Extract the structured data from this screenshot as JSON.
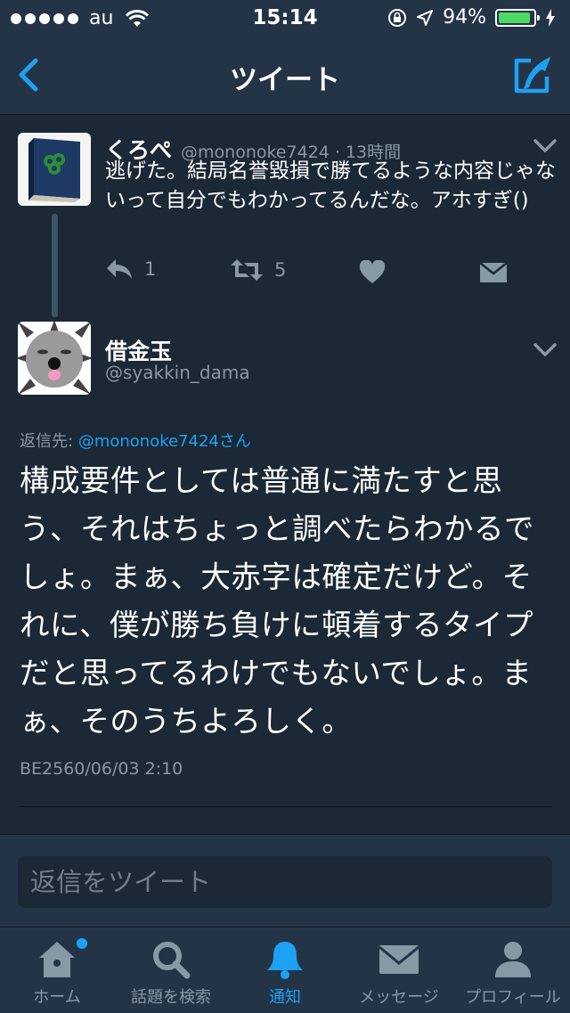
{
  "status_bar": {
    "carrier": "au",
    "time": "15:14",
    "battery_percent": "94%",
    "battery_level": 0.94
  },
  "nav": {
    "title": "ツイート"
  },
  "parent_tweet": {
    "name": "くろぺ",
    "handle": "@mononoke7424",
    "separator": "·",
    "time": "13時間",
    "text": "逃げた。結局名誉毀損で勝てるような内容じゃないって自分でもわかってるんだな。アホすぎ()",
    "reply_count": "1",
    "retweet_count": "5"
  },
  "main_tweet": {
    "name": "借金玉",
    "handle": "@syakkin_dama",
    "reply_to_label": "返信先:",
    "reply_to_handle": "@mononoke7424さん",
    "text": "構成要件としては普通に満たすと思う、それはちょっと調べたらわかるでしょ。まぁ、大赤字は確定だけど。それに、僕が勝ち負けに頓着するタイプだと思ってるわけでもないでしょ。まぁ、そのうちよろしく。",
    "timestamp": "BE2560/06/03 2:10"
  },
  "reply_box": {
    "placeholder": "返信をツイート"
  },
  "tabs": [
    {
      "label": "ホーム",
      "icon": "home-icon"
    },
    {
      "label": "話題を検索",
      "icon": "search-icon"
    },
    {
      "label": "通知",
      "icon": "bell-icon"
    },
    {
      "label": "メッセージ",
      "icon": "envelope-icon"
    },
    {
      "label": "プロフィール",
      "icon": "profile-icon"
    }
  ],
  "colors": {
    "accent": "#1da1f2",
    "background": "#1b2836",
    "bar": "#243447",
    "muted": "#8899a6"
  }
}
